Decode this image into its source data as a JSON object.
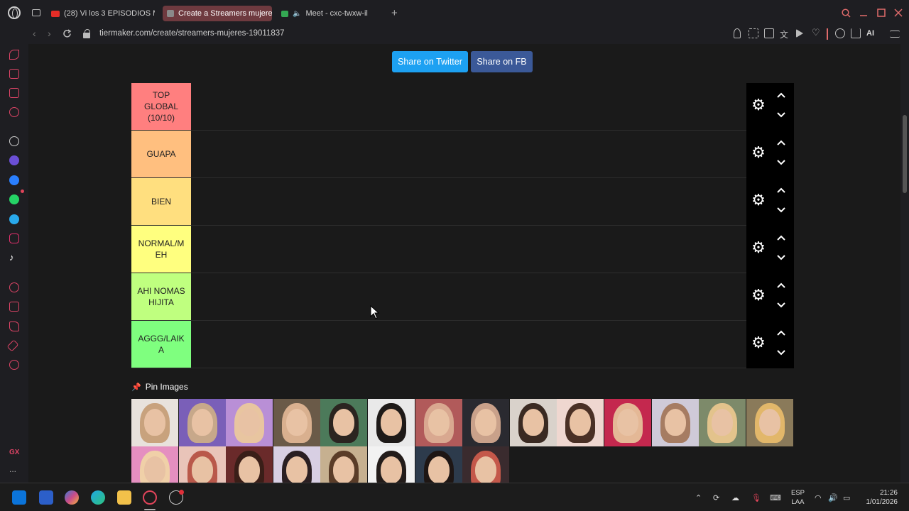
{
  "browser": {
    "tabs": [
      {
        "label": "(28) Vi los 3 EPISODIOS M",
        "active": false,
        "favicon_color": "#e52d27"
      },
      {
        "label": "Create a Streamers mujere",
        "active": true,
        "favicon_color": "#7a7a7a"
      },
      {
        "label": "Meet - cxc-twxw-il",
        "active": false,
        "favicon_color": "#34a853"
      }
    ],
    "url": "tiermaker.com/create/streamers-mujeres-19011837",
    "ai_label": "AI"
  },
  "sidebar": {
    "gx_label": "GX",
    "more_label": "..."
  },
  "share": {
    "twitter_label": "Share on Twitter",
    "fb_label": "Share on FB"
  },
  "tiers": [
    {
      "label": "TOP GLOBAL (10/10)",
      "color": "#ff7f7f"
    },
    {
      "label": "GUAPA",
      "color": "#ffbf7f"
    },
    {
      "label": "BIEN",
      "color": "#ffdf7f"
    },
    {
      "label": "NORMAL/MEH",
      "color": "#ffff7f"
    },
    {
      "label": "AHI NOMAS HIJITA",
      "color": "#bfff7f"
    },
    {
      "label": "AGGG/LAIKA",
      "color": "#7fff7f"
    }
  ],
  "tier_lines": [
    [
      "TOP",
      "GLOBAL",
      "(10/10)"
    ],
    [
      "GUAPA"
    ],
    [
      "BIEN"
    ],
    [
      "NORMAL/M",
      "EH"
    ],
    [
      "AHI NOMAS",
      "HIJITA"
    ],
    [
      "AGGG/LAIK",
      "A"
    ]
  ],
  "pin_images_label": "Pin Images",
  "image_palette": [
    [
      "#e8e2dc",
      "#c8a27d"
    ],
    [
      "#7a5fb8",
      "#c7a88a"
    ],
    [
      "#b98fd6",
      "#e8c5a0"
    ],
    [
      "#6a5a48",
      "#d9b08f"
    ],
    [
      "#4c7a5a",
      "#2b2420"
    ],
    [
      "#e9e9e9",
      "#1e1a18"
    ],
    [
      "#b15a5a",
      "#d9a890"
    ],
    [
      "#2a2a30",
      "#c9a18a"
    ],
    [
      "#d9d2cb",
      "#3a2a22"
    ],
    [
      "#efd7d0",
      "#4a3025"
    ],
    [
      "#c4284e",
      "#e4b896"
    ],
    [
      "#cfcad8",
      "#a67c62"
    ],
    [
      "#7d8a6a",
      "#e3c38c"
    ],
    [
      "#8a7a5a",
      "#e2b76a"
    ],
    [
      "#e58fc0",
      "#f0d0a8"
    ],
    [
      "#e9c4b9",
      "#b9584a"
    ],
    [
      "#6a2a2a",
      "#3a1e18"
    ],
    [
      "#d8cfe3",
      "#2a1f22"
    ],
    [
      "#c6b090",
      "#5a3c28"
    ],
    [
      "#f2f2f2",
      "#231c1a"
    ],
    [
      "#2d3b4c",
      "#1e1614"
    ],
    [
      "#3a2b2e",
      "#c4584a"
    ]
  ],
  "taskbar": {
    "lang_line1": "ESP",
    "lang_line2": "LAA",
    "time": "21:26",
    "date": "1/01/2026"
  }
}
